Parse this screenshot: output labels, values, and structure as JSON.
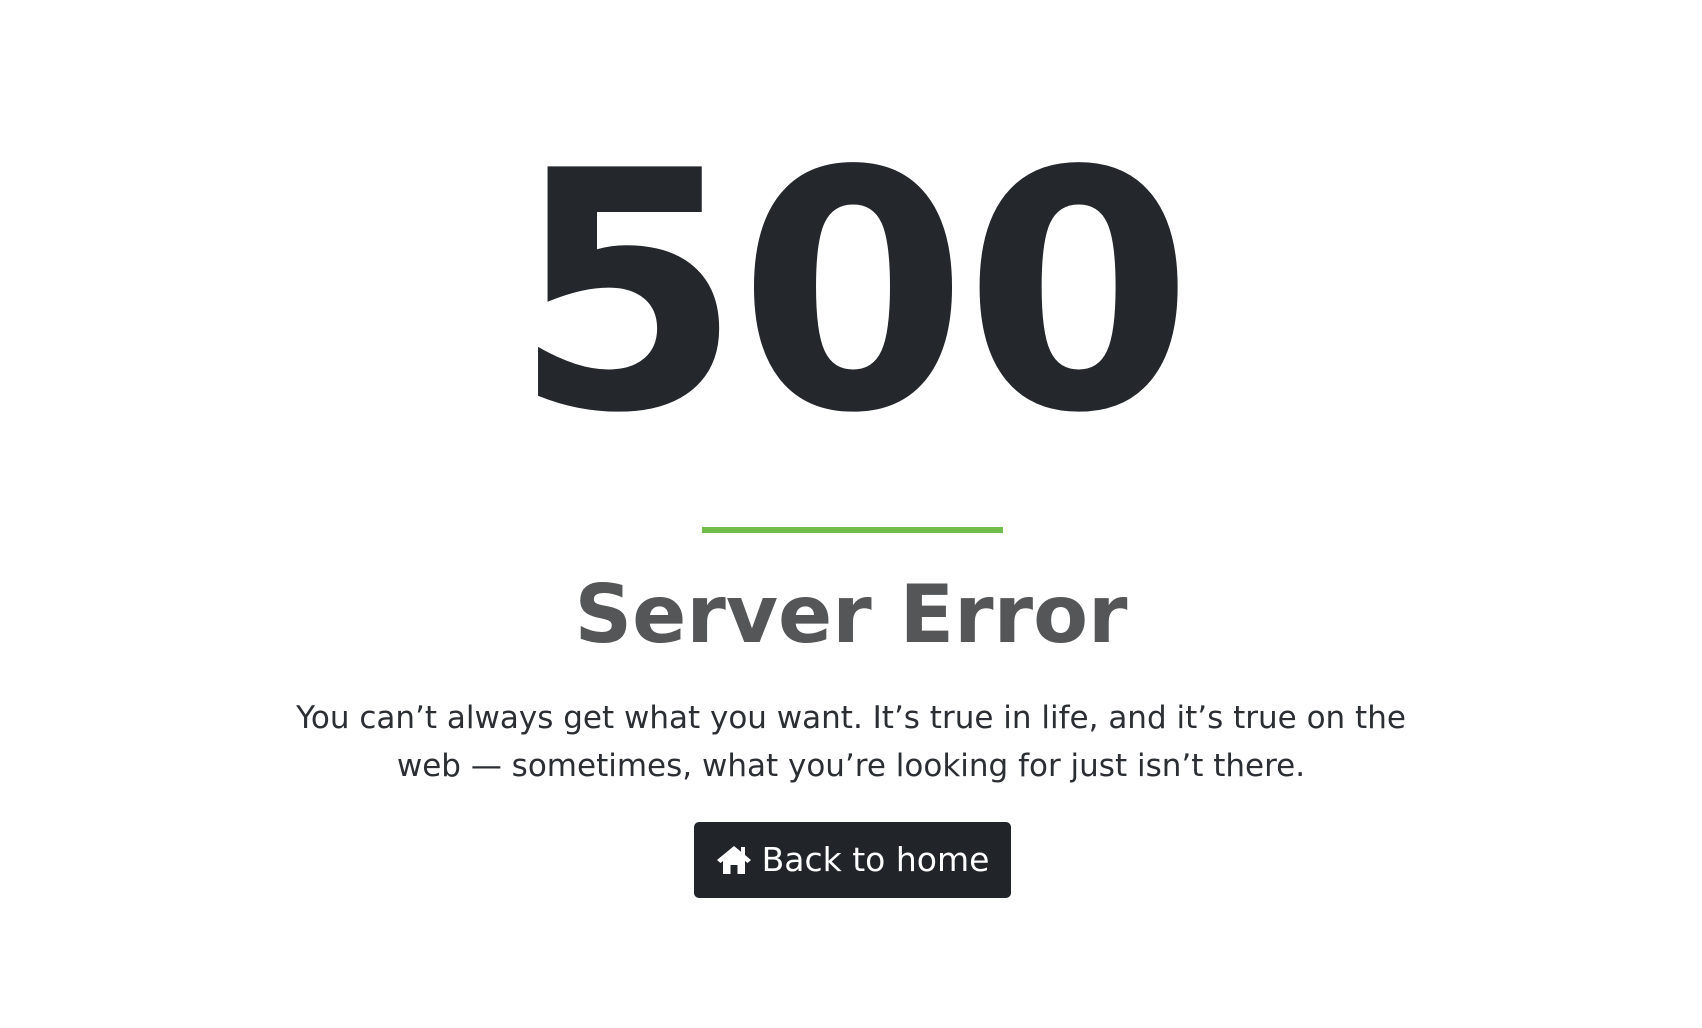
{
  "error": {
    "code": "500",
    "title": "Server Error",
    "message": "You can’t always get what you want. It’s true in life, and it’s true on the web — sometimes, what you’re looking for just isn’t there."
  },
  "home_button": {
    "label": "Back to home",
    "icon": "home-icon"
  },
  "colors": {
    "accent": "#71bc4a",
    "code_text": "#24272b",
    "title_text": "#555657",
    "button_bg": "#212529",
    "background": "#ffffff"
  }
}
